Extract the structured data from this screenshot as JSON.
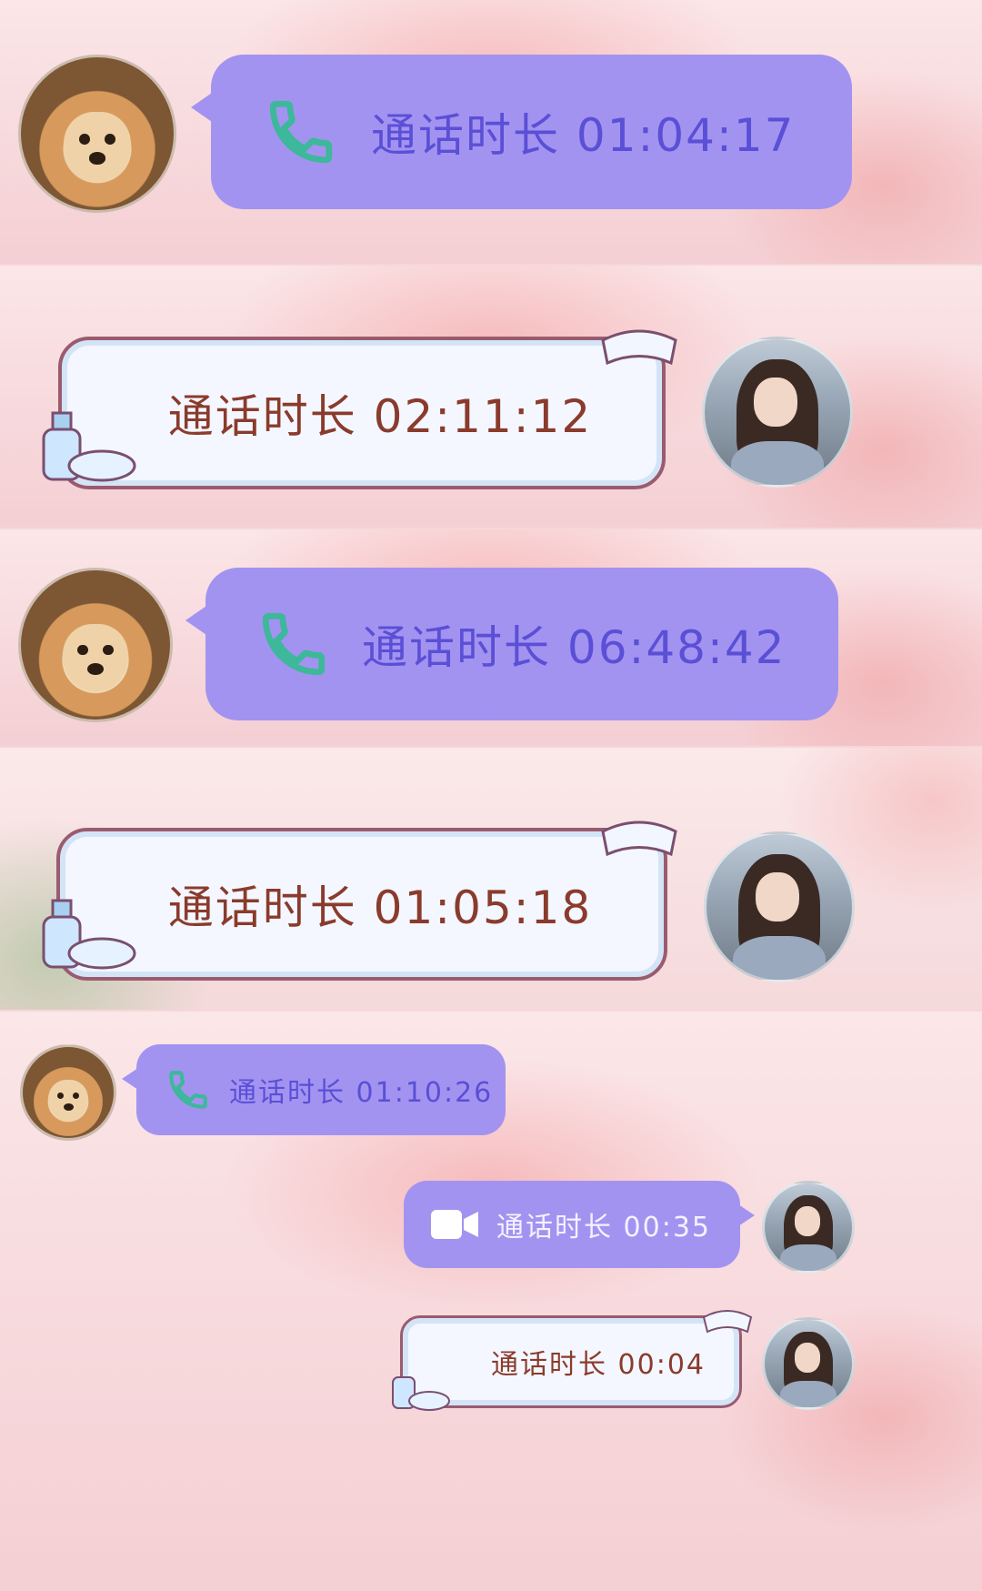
{
  "calls": [
    {
      "sender": "dog",
      "style": "purple",
      "icon": "phone-icon",
      "text": "通话时长 01:04:17"
    },
    {
      "sender": "girl",
      "style": "white",
      "icon": "none",
      "text": "通话时长 02:11:12"
    },
    {
      "sender": "dog",
      "style": "purple",
      "icon": "phone-icon",
      "text": "通话时长 06:48:42"
    },
    {
      "sender": "girl",
      "style": "white",
      "icon": "none",
      "text": "通话时长 01:05:18"
    },
    {
      "sender": "dog",
      "style": "purple",
      "icon": "phone-icon",
      "text": "通话时长 01:10:26"
    },
    {
      "sender": "girl",
      "style": "purple",
      "icon": "video-camera-icon",
      "text": "通话时长 00:35"
    },
    {
      "sender": "girl",
      "style": "white",
      "icon": "none",
      "text": "通话时长 00:04"
    }
  ],
  "colors": {
    "purple_bubble": "#a393f0",
    "purple_text": "#5a4fd6",
    "phone_icon": "#3db89a",
    "white_bubble_text": "#8a3b2c"
  }
}
